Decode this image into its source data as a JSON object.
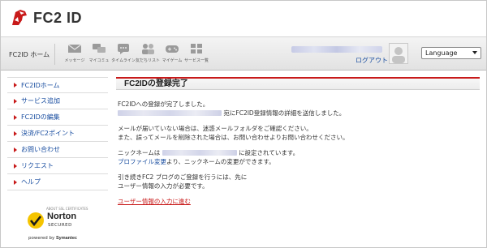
{
  "brand": {
    "name": "FC2 ID"
  },
  "header": {
    "home_label": "FC2ID ホーム",
    "nav_items": [
      {
        "label": "メッセージ",
        "icon": "mail-icon"
      },
      {
        "label": "マイコミュ",
        "icon": "community-icon"
      },
      {
        "label": "タイムライン",
        "icon": "timeline-icon"
      },
      {
        "label": "友だちリスト",
        "icon": "friends-icon"
      },
      {
        "label": "マイゲーム",
        "icon": "game-icon"
      },
      {
        "label": "サービス一覧",
        "icon": "services-icon"
      }
    ],
    "logout_label": "ログアウト",
    "language_selected": "Language"
  },
  "sidebar": {
    "items": [
      {
        "label": "FC2IDホーム"
      },
      {
        "label": "サービス追加"
      },
      {
        "label": "FC2IDの編集"
      },
      {
        "label": "決済/FC2ポイント"
      },
      {
        "label": "お問い合わせ"
      },
      {
        "label": "リクエスト"
      },
      {
        "label": "ヘルプ"
      }
    ],
    "norton": {
      "top_text": "ABOUT SSL CERTIFICATES",
      "brand": "Norton",
      "secured": "SECURED",
      "powered_by": "powered by",
      "symantec": "Symantec"
    }
  },
  "main": {
    "title": "FC2IDの登録完了",
    "p1_line1": "FC2IDへの登録が完了しました。",
    "p1_line2_suffix": "宛にFC2ID登録情報の詳細を送信しました。",
    "p2_line1": "メールが届いていない場合は、迷惑メールフォルダをご確認ください。",
    "p2_line2": "また、誤ってメールを削除された場合は、お問い合わせよりお問い合わせください。",
    "p3_prefix": "ニックネームは",
    "p3_suffix": "に設定されています。",
    "p3_link": "プロファイル変更",
    "p3_line2_suffix": "より、ニックネームの変更ができます。",
    "p4_line1": "引き続きFC2 ブログのご登録を行うには、先に",
    "p4_line2": "ユーザー情報の入力が必要です。",
    "cta_link": "ユーザー情報の入力に進む"
  },
  "colors": {
    "accent_red": "#c81a1a",
    "link_blue": "#1a4ea0"
  }
}
